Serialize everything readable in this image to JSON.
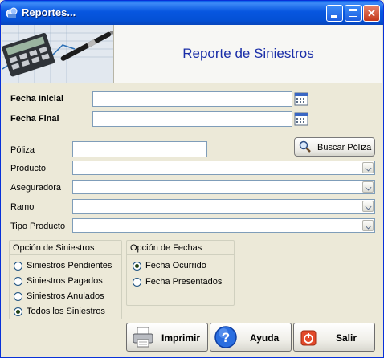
{
  "window": {
    "title": "Reportes...",
    "icon": "reports-icon",
    "controls": [
      "minimize-icon",
      "maximize-icon",
      "close-icon"
    ]
  },
  "header": {
    "title": "Reporte de Siniestros",
    "image": "finance-photo"
  },
  "dates": {
    "start_label": "Fecha Inicial",
    "start_value": "",
    "end_label": "Fecha Final",
    "end_value": ""
  },
  "filters": {
    "poliza_label": "Póliza",
    "poliza_value": "",
    "buscar_label": "Buscar Póliza",
    "producto_label": "Producto",
    "producto_value": "",
    "aseguradora_label": "Aseguradora",
    "aseguradora_value": "",
    "ramo_label": "Ramo",
    "ramo_value": "",
    "tipo_label": "Tipo Producto",
    "tipo_value": ""
  },
  "siniestros": {
    "title": "Opción de Siniestros",
    "options": [
      "Siniestros Pendientes",
      "Siniestros Pagados",
      "Siniestros Anulados",
      "Todos los Siniestros"
    ],
    "selected": "Todos los Siniestros"
  },
  "fechas": {
    "title": "Opción de Fechas",
    "options": [
      "Fecha Ocurrido",
      "Fecha Presentados"
    ],
    "selected": "Fecha Ocurrido"
  },
  "actions": {
    "print_label": "Imprimir",
    "help_label": "Ayuda",
    "exit_label": "Salir"
  },
  "colors": {
    "titlebar": "#0756e0",
    "header_text": "#1a2ea8",
    "window_bg": "#ece9d8"
  }
}
